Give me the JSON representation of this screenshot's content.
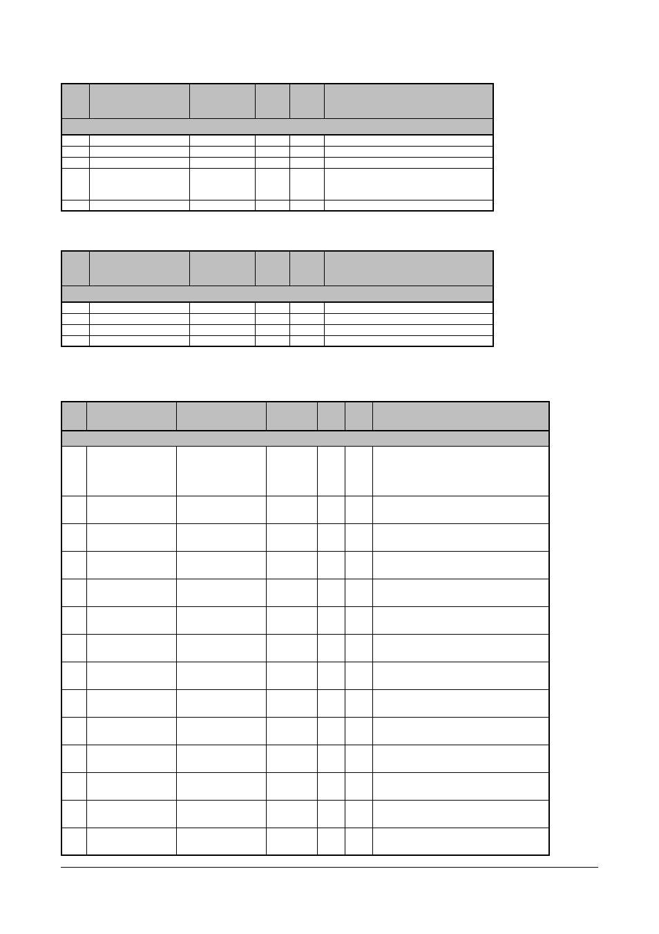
{
  "tables": {
    "table1": {
      "headers": [
        "",
        "",
        "",
        "",
        "",
        ""
      ],
      "band": "",
      "rows": [
        [
          "",
          "",
          "",
          "",
          "",
          ""
        ],
        [
          "",
          "",
          "",
          "",
          "",
          ""
        ],
        [
          "",
          "",
          "",
          "",
          "",
          ""
        ],
        [
          "",
          "",
          "",
          "",
          "",
          ""
        ],
        [
          "",
          "",
          "",
          "",
          "",
          ""
        ]
      ],
      "tall_row_index": 3
    },
    "table2": {
      "headers": [
        "",
        "",
        "",
        "",
        "",
        ""
      ],
      "band": "",
      "rows": [
        [
          "",
          "",
          "",
          "",
          "",
          ""
        ],
        [
          "",
          "",
          "",
          "",
          "",
          ""
        ],
        [
          "",
          "",
          "",
          "",
          "",
          ""
        ],
        [
          "",
          "",
          "",
          "",
          "",
          ""
        ]
      ]
    },
    "table3": {
      "headers": [
        "",
        "",
        "",
        "",
        "",
        "",
        ""
      ],
      "band": "",
      "rows": [
        [
          "",
          "",
          "",
          "",
          "",
          "",
          ""
        ],
        [
          "",
          "",
          "",
          "",
          "",
          "",
          ""
        ],
        [
          "",
          "",
          "",
          "",
          "",
          "",
          ""
        ],
        [
          "",
          "",
          "",
          "",
          "",
          "",
          ""
        ],
        [
          "",
          "",
          "",
          "",
          "",
          "",
          ""
        ],
        [
          "",
          "",
          "",
          "",
          "",
          "",
          ""
        ],
        [
          "",
          "",
          "",
          "",
          "",
          "",
          ""
        ],
        [
          "",
          "",
          "",
          "",
          "",
          "",
          ""
        ],
        [
          "",
          "",
          "",
          "",
          "",
          "",
          ""
        ],
        [
          "",
          "",
          "",
          "",
          "",
          "",
          ""
        ],
        [
          "",
          "",
          "",
          "",
          "",
          "",
          ""
        ],
        [
          "",
          "",
          "",
          "",
          "",
          "",
          ""
        ],
        [
          "",
          "",
          "",
          "",
          "",
          "",
          ""
        ],
        [
          "",
          "",
          "",
          "",
          "",
          "",
          ""
        ]
      ],
      "big_row_index": 0
    }
  }
}
